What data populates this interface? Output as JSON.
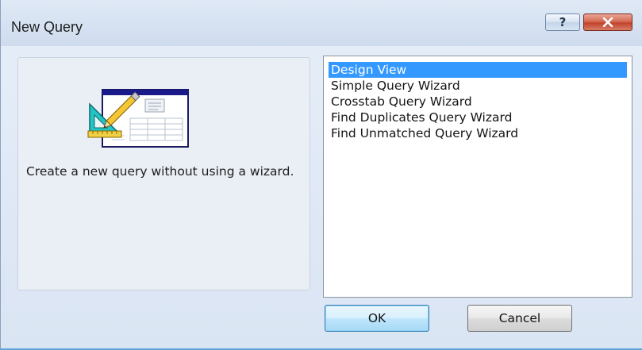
{
  "window": {
    "title": "New Query",
    "help_label": "?"
  },
  "left_panel": {
    "description": "Create a new query without using a wizard."
  },
  "query_types": {
    "selected": "Design View",
    "items": [
      "Design View",
      "Simple Query Wizard",
      "Crosstab Query Wizard",
      "Find Duplicates Query Wizard",
      "Find Unmatched Query Wizard"
    ]
  },
  "buttons": {
    "ok_label": "OK",
    "cancel_label": "Cancel"
  },
  "colors": {
    "selection": "#3399ff",
    "close_button": "#c2432b"
  },
  "icons": {
    "help": "help-icon",
    "close": "close-icon",
    "illustration": "design-view-icon"
  }
}
